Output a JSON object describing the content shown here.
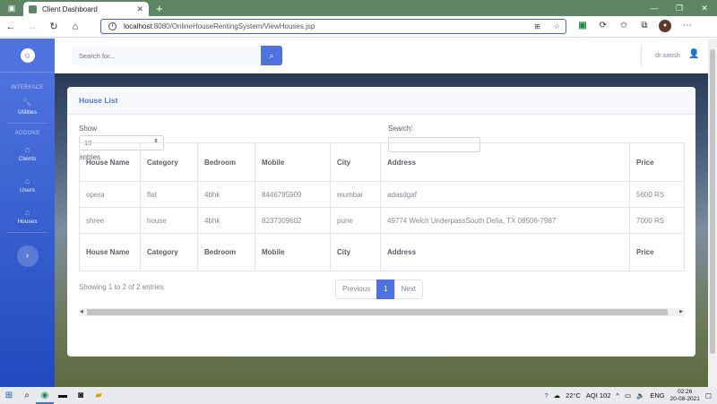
{
  "browser": {
    "tab_title": "Client Dashboard",
    "url_host": "localhost",
    "url_path": ":8080/OnlineHouseRentingSystem/ViewHouses.jsp"
  },
  "sidebar": {
    "brand_icon": "laugh-wink-icon",
    "heading_interface": "INTERFACE",
    "heading_addons": "ADDONS",
    "items": [
      {
        "label": "Utilities",
        "icon": "wrench-icon"
      },
      {
        "label": "Clients",
        "icon": "home-icon"
      },
      {
        "label": "Users",
        "icon": "home-icon"
      },
      {
        "label": "Houses",
        "icon": "home-icon"
      }
    ]
  },
  "topbar": {
    "search_placeholder": "Search for...",
    "username": "dr.satish"
  },
  "card": {
    "title": "House List",
    "show_label": "Show",
    "page_length": "10",
    "entries_label": "entries",
    "search_label": "Search:",
    "columns": [
      "House Name",
      "Category",
      "Bedroom",
      "Mobile",
      "City",
      "Address",
      "Price"
    ],
    "rows": [
      [
        "opera",
        "flat",
        "4bhk",
        "8446785909",
        "mumbai",
        "adasdgaf",
        "5600 RS"
      ],
      [
        "shree",
        "house",
        "4bhk",
        "8237309602",
        "pune",
        "49774 Welch UnderpassSouth Delia, TX 08506-7987",
        "7000 RS"
      ]
    ],
    "info": "Showing 1 to 2 of 2 entries",
    "pager": {
      "previous": "Previous",
      "current": "1",
      "next": "Next"
    }
  },
  "taskbar": {
    "weather": "22°C",
    "aqi": "AQI 102",
    "language": "ENG",
    "time": "02:26",
    "date": "20-08-2021"
  },
  "colors": {
    "primary": "#4e73df",
    "tabbar": "#5e8564"
  }
}
